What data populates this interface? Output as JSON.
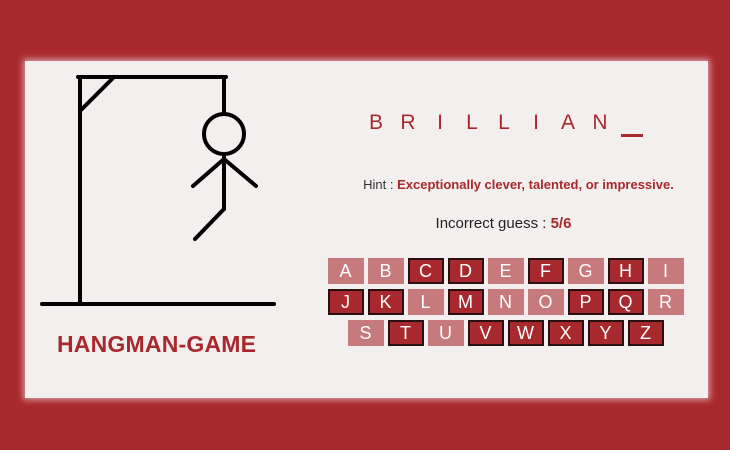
{
  "game": {
    "title": "HANGMAN-GAME",
    "word_slots": [
      "B",
      "R",
      "I",
      "L",
      "L",
      "I",
      "A",
      "N",
      ""
    ],
    "hint_label": "Hint :",
    "hint_text": "Exceptionally clever, talented, or impressive.",
    "guesses_label": "Incorrect guess :",
    "guesses_value": "5/6"
  },
  "keyboard": [
    {
      "letter": "A",
      "used": true
    },
    {
      "letter": "B",
      "used": true
    },
    {
      "letter": "C",
      "used": false
    },
    {
      "letter": "D",
      "used": false
    },
    {
      "letter": "E",
      "used": true
    },
    {
      "letter": "F",
      "used": false
    },
    {
      "letter": "G",
      "used": true
    },
    {
      "letter": "H",
      "used": false
    },
    {
      "letter": "I",
      "used": true
    },
    {
      "letter": "J",
      "used": false
    },
    {
      "letter": "K",
      "used": false
    },
    {
      "letter": "L",
      "used": true
    },
    {
      "letter": "M",
      "used": false
    },
    {
      "letter": "N",
      "used": true
    },
    {
      "letter": "O",
      "used": true
    },
    {
      "letter": "P",
      "used": false
    },
    {
      "letter": "Q",
      "used": false
    },
    {
      "letter": "R",
      "used": true
    },
    {
      "letter": "S",
      "used": true
    },
    {
      "letter": "T",
      "used": false
    },
    {
      "letter": "U",
      "used": true
    },
    {
      "letter": "V",
      "used": false
    },
    {
      "letter": "W",
      "used": false
    },
    {
      "letter": "X",
      "used": false
    },
    {
      "letter": "Y",
      "used": false
    },
    {
      "letter": "Z",
      "used": false
    }
  ],
  "colors": {
    "accent": "#a8292d",
    "used_key": "#c67a7c",
    "panel": "#f3efef"
  }
}
